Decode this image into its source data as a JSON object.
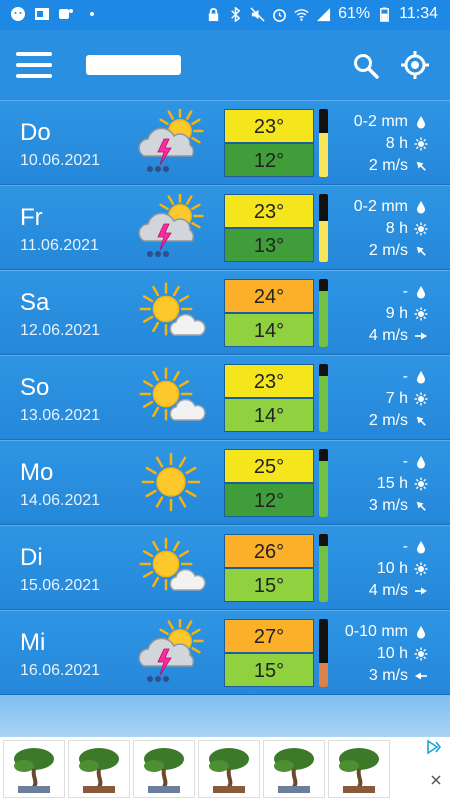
{
  "status_bar": {
    "battery": "61%",
    "time": "11:34"
  },
  "app_bar": {
    "location_title": ""
  },
  "colors": {
    "primary": "#2a8fe0",
    "temp_yellow": "#f5e51d",
    "temp_orange": "#fcb02a",
    "temp_green_dark": "#3f9e3a",
    "temp_green_light": "#8fd13f",
    "bar_yellow": "#f7e55a",
    "bar_green": "#72c044",
    "bar_orange": "#d9824a"
  },
  "days": [
    {
      "name": "Do",
      "date": "10.06.2021",
      "icon": "thunderstorm-icon",
      "hi": "23°",
      "lo": "12°",
      "hi_color": "#f5e51d",
      "lo_color": "#3f9e3a",
      "bar_level": 0.65,
      "bar_color": "#f7e55a",
      "rain": "0-2 mm",
      "sun": "8 h",
      "wind": "2 m/s",
      "wind_dir": "southwest-arrow-icon"
    },
    {
      "name": "Fr",
      "date": "11.06.2021",
      "icon": "thunderstorm-icon",
      "hi": "23°",
      "lo": "13°",
      "hi_color": "#f5e51d",
      "lo_color": "#3f9e3a",
      "bar_level": 0.6,
      "bar_color": "#f7e55a",
      "rain": "0-2 mm",
      "sun": "8 h",
      "wind": "2 m/s",
      "wind_dir": "southwest-arrow-icon"
    },
    {
      "name": "Sa",
      "date": "12.06.2021",
      "icon": "partly-sunny-icon",
      "hi": "24°",
      "lo": "14°",
      "hi_color": "#fcb02a",
      "lo_color": "#8fd13f",
      "bar_level": 0.82,
      "bar_color": "#72c044",
      "rain": "-",
      "sun": "9 h",
      "wind": "4 m/s",
      "wind_dir": "east-arrow-icon"
    },
    {
      "name": "So",
      "date": "13.06.2021",
      "icon": "partly-sunny-icon",
      "hi": "23°",
      "lo": "14°",
      "hi_color": "#f5e51d",
      "lo_color": "#8fd13f",
      "bar_level": 0.82,
      "bar_color": "#72c044",
      "rain": "-",
      "sun": "7 h",
      "wind": "2 m/s",
      "wind_dir": "southwest-arrow-icon"
    },
    {
      "name": "Mo",
      "date": "14.06.2021",
      "icon": "sunny-icon",
      "hi": "25°",
      "lo": "12°",
      "hi_color": "#f5e51d",
      "lo_color": "#3f9e3a",
      "bar_level": 0.82,
      "bar_color": "#72c044",
      "rain": "-",
      "sun": "15 h",
      "wind": "3 m/s",
      "wind_dir": "southwest-arrow-icon"
    },
    {
      "name": "Di",
      "date": "15.06.2021",
      "icon": "partly-sunny-icon",
      "hi": "26°",
      "lo": "15°",
      "hi_color": "#fcb02a",
      "lo_color": "#8fd13f",
      "bar_level": 0.82,
      "bar_color": "#72c044",
      "rain": "-",
      "sun": "10 h",
      "wind": "4 m/s",
      "wind_dir": "east-arrow-icon"
    },
    {
      "name": "Mi",
      "date": "16.06.2021",
      "icon": "thunderstorm-icon",
      "hi": "27°",
      "lo": "15°",
      "hi_color": "#fcb02a",
      "lo_color": "#8fd13f",
      "bar_level": 0.35,
      "bar_color": "#d9824a",
      "rain": "0-10 mm",
      "sun": "10 h",
      "wind": "3 m/s",
      "wind_dir": "west-arrow-icon"
    }
  ],
  "ad": {
    "items": [
      "bonsai-1",
      "bonsai-2",
      "bonsai-3",
      "bonsai-4",
      "bonsai-5",
      "bonsai-6"
    ]
  }
}
